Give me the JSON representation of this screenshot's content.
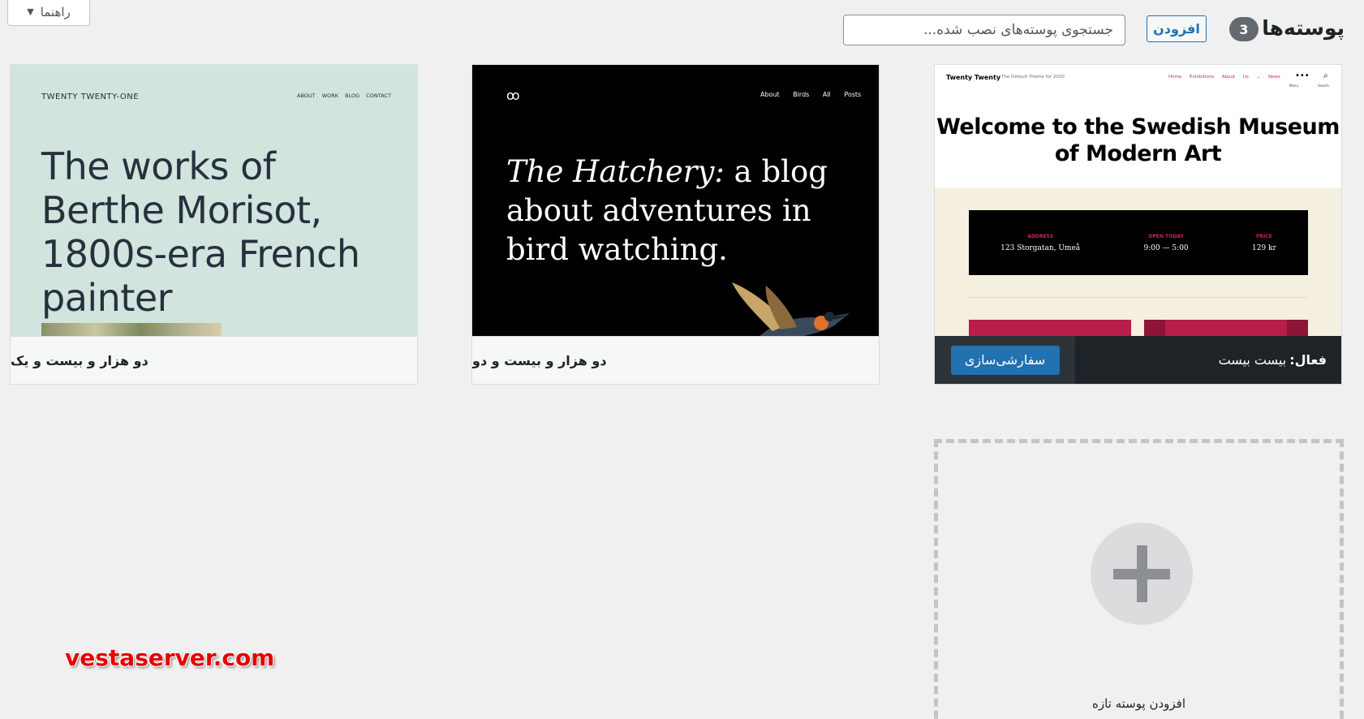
{
  "header": {
    "title": "پوسته‌ها",
    "count": "3",
    "add_label": "افزودن",
    "search_placeholder": "جستجوی پوسته‌های نصب شده...",
    "help_label": "راهنما"
  },
  "themes": [
    {
      "name": "بیست بیست",
      "active": true,
      "active_prefix": "فعال:",
      "customize_label": "سفارشی‌سازی",
      "shot": {
        "brand": "Twenty Twenty",
        "tagline": "The Default Theme for 2020",
        "nav": [
          "Home",
          "Exhibitions",
          "About Us ⌄",
          "News"
        ],
        "menu_label": "Menu",
        "search_label": "Search",
        "headline": "Welcome to the Swedish Museum of Modern Art",
        "info": [
          {
            "label": "ADDRESS",
            "value": "123 Storgatan, Umeå"
          },
          {
            "label": "OPEN TODAY",
            "value": "9:00 — 5:00"
          },
          {
            "label": "PRICE",
            "value": "129 kr"
          }
        ]
      }
    },
    {
      "name": "دو هزار و بیست و دو",
      "active": false,
      "shot": {
        "logo": "oo",
        "nav": [
          "About",
          "Birds",
          "All Posts"
        ],
        "headline_italic": "The Hatchery:",
        "headline_rest": " a blog about adventures in bird watching."
      }
    },
    {
      "name": "دو هزار و بیست و یک",
      "active": false,
      "shot": {
        "brand": "TWENTY TWENTY-ONE",
        "nav": [
          "ABOUT",
          "WORK",
          "BLOG",
          "CONTACT"
        ],
        "headline": "The works of Berthe Morisot, 1800s-era French painter"
      }
    }
  ],
  "add_new_label": "افزودن پوسته تازه",
  "watermark": "vestaserver.com",
  "colors": {
    "accent": "#2271b1",
    "dark_bar": "#1d2327",
    "tt_pink": "#cd2653",
    "t21_bg": "#d1e4dd"
  }
}
